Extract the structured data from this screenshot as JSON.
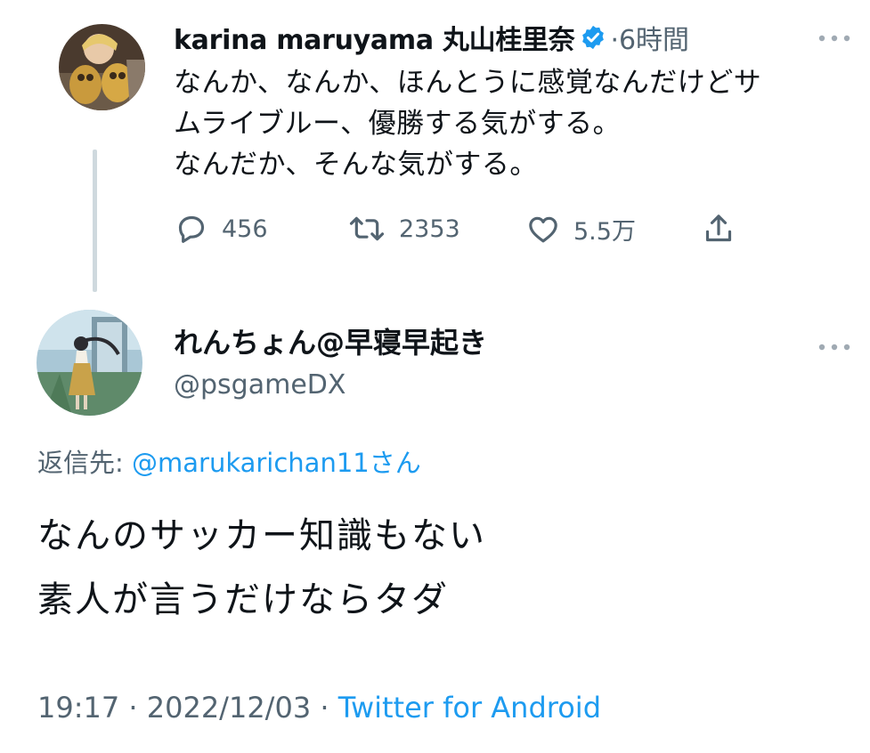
{
  "parent_tweet": {
    "author_name": "karina maruyama 丸山桂里奈",
    "verified": true,
    "time": "·6時間",
    "lines": [
      "なんか、なんか、ほんとうに感覚なんだけどサ",
      "ムライブルー、優勝する気がする。",
      "なんだか、そんな気がする。"
    ],
    "actions": {
      "reply_count": "456",
      "retweet_count": "2353",
      "like_count": "5.5万"
    },
    "icons": {
      "more": "more-icon",
      "reply": "reply-icon",
      "retweet": "retweet-icon",
      "like": "heart-icon",
      "share": "share-icon",
      "verified": "verified-badge-icon"
    }
  },
  "reply_tweet": {
    "author_name": "れんちょん@早寝早起き",
    "handle": "@psgameDX",
    "reply_to_label": "返信先: ",
    "reply_to_mention": "@marukarichan11",
    "reply_to_suffix": "さん",
    "lines": [
      "なんのサッカー知識もない",
      "素人が言うだけならタダ"
    ],
    "timestamp": "19:17 · 2022/12/03 · ",
    "source": "Twitter for Android"
  },
  "colors": {
    "text": "#0f1419",
    "secondary": "#536471",
    "link": "#1d9bf0",
    "thread_line": "#cfd9de",
    "background": "#ffffff"
  }
}
